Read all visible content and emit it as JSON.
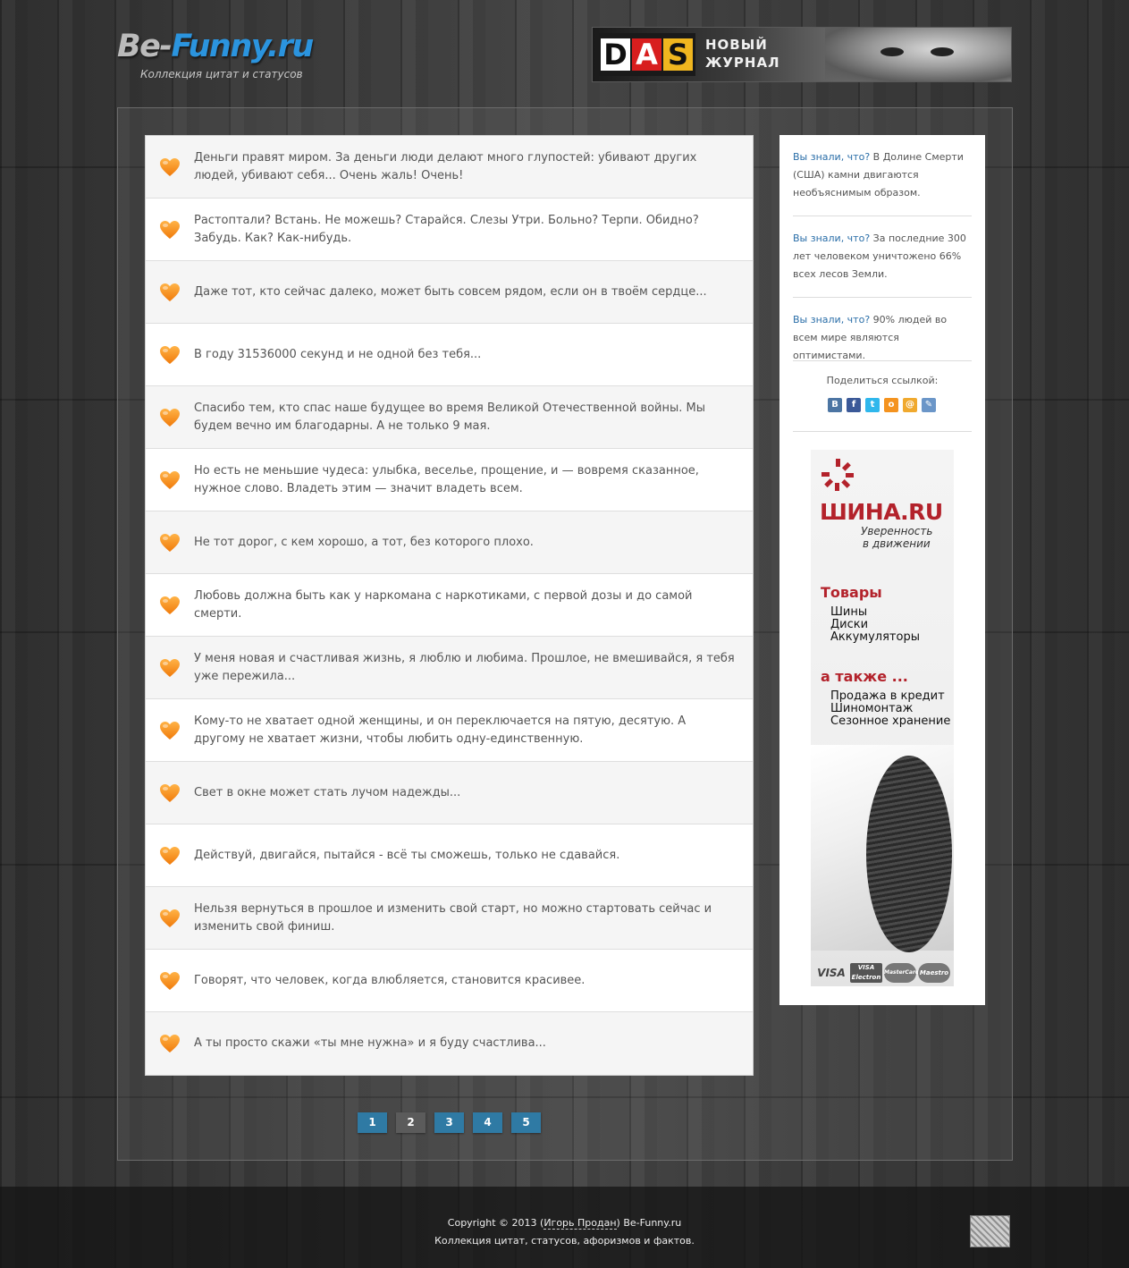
{
  "header": {
    "logo_part1": "Be-",
    "logo_part2": "Funny.ru",
    "tagline": "Коллекция цитат и статусов",
    "banner": {
      "letters": [
        "D",
        "A",
        "S"
      ],
      "line1": "НОВЫЙ",
      "line2": "ЖУРНАЛ"
    }
  },
  "quotes": [
    {
      "text": "Деньги правят миром. За деньги люди делают много глупостей: убивают других людей, убивают себя... Очень жаль! Очень!"
    },
    {
      "text": "Растоптали? Встань. Не можешь? Старайся. Слезы Утри. Больно? Терпи. Обидно? Забудь. Как? Как-нибудь."
    },
    {
      "text": "Даже тот, кто сейчас далеко, может быть совсем рядом, если он в твоём сердце..."
    },
    {
      "text": "В году 31536000 секунд и не одной без тебя..."
    },
    {
      "text": "Спасибо тем, кто спас наше будущее во время Великой Отечественной войны. Мы будем вечно им благодарны. А не только 9 мая."
    },
    {
      "text": "Но есть не меньшие чудеса: улыбка, веселье, прощение, и — вовремя сказанное, нужное слово. Владеть этим — значит владеть всем."
    },
    {
      "text": "Не тот дорог, с кем хорошо, а тот, без которого плохо."
    },
    {
      "text": "Любовь должна быть как у наркомана с наркотиками, с первой дозы и до самой смерти."
    },
    {
      "text": "У меня новая и счастливая жизнь, я люблю и любима. Прошлое, не вмешивайся, я тебя уже пережила..."
    },
    {
      "text": "Кому-то не хватает одной женщины, и он переключается на пятую, десятую. А другому не хватает жизни, чтобы любить одну-единственную."
    },
    {
      "text": "Свет в окне может стать лучом надежды..."
    },
    {
      "text": "Действуй, двигайся, пытайся - всё ты сможешь, только не сдавайся."
    },
    {
      "text": "Нельзя вернуться в прошлое и изменить свой старт, но можно стартовать сейчас и изменить свой финиш."
    },
    {
      "text": "Говорят, что человек, когда влюбляется, становится красивее."
    },
    {
      "text": "А ты просто скажи «ты мне нужна» и я буду счастлива..."
    }
  ],
  "pagination": {
    "pages": [
      "1",
      "2",
      "3",
      "4",
      "5"
    ],
    "current": "2"
  },
  "sidebar": {
    "facts": [
      {
        "link": "Вы знали, что?",
        "text": " В Долине Смерти (США) камни двигаются необъяснимым образом."
      },
      {
        "link": "Вы знали, что?",
        "text": " За последние 300 лет человеком уничтожено 66% всех лесов Земли."
      },
      {
        "link": "Вы знали, что?",
        "text": " 90% людей во всем мире являются оптимистами."
      }
    ],
    "share_label": "Поделиться ссылкой:",
    "share_icons": [
      {
        "name": "vkontakte-icon",
        "glyph": "B",
        "color": "#4c75a3"
      },
      {
        "name": "facebook-icon",
        "glyph": "f",
        "color": "#3b5998"
      },
      {
        "name": "twitter-icon",
        "glyph": "t",
        "color": "#2fb7ec"
      },
      {
        "name": "odnoklassniki-icon",
        "glyph": "o",
        "color": "#f4931f"
      },
      {
        "name": "mailru-icon",
        "glyph": "@",
        "color": "#f0a92e"
      },
      {
        "name": "bookmark-icon",
        "glyph": "✎",
        "color": "#6b96c8"
      }
    ],
    "ad": {
      "brand": "ШИНА.RU",
      "slogan_line1": "Уверенность",
      "slogan_line2": "в движении",
      "heading1": "Товары",
      "items1": [
        "Шины",
        "Диски",
        "Аккумуляторы"
      ],
      "heading2": "а также ...",
      "items2": [
        "Продажа в кредит",
        "Шиномонтаж",
        "Сезонное хранение"
      ],
      "cards": [
        "VISA",
        "VISA Electron",
        "MasterCard",
        "Maestro"
      ]
    }
  },
  "footer": {
    "copyright_prefix": "Copyright © 2013 (",
    "author": "Игорь Продан",
    "copyright_suffix": ") Be-Funny.ru",
    "line2": "Коллекция цитат, статусов, афоризмов и фактов."
  },
  "colors": {
    "accent": "#2b94de",
    "heart": "#f7931e",
    "pager": "#2f7aa4",
    "pager_active": "#5b5b5b",
    "ad_brand": "#b3222b"
  }
}
